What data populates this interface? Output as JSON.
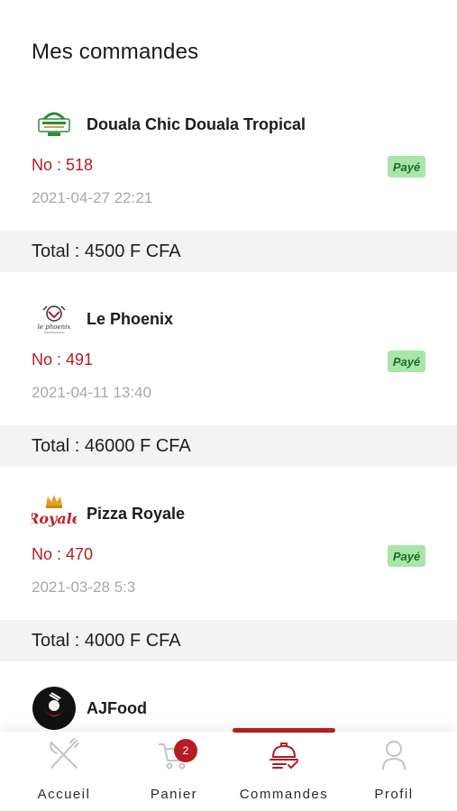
{
  "page": {
    "title": "Mes commandes"
  },
  "orders": [
    {
      "restaurant": "Douala Chic Douala Tropical",
      "number": "No : 518",
      "status": "Payé",
      "date": "2021-04-27 22:21",
      "total": "Total : 4500 F CFA",
      "logo": "douala-chic-logo"
    },
    {
      "restaurant": "Le Phoenix",
      "number": "No : 491",
      "status": "Payé",
      "date": "2021-04-11 13:40",
      "total": "Total : 46000 F CFA",
      "logo": "le-phoenix-logo"
    },
    {
      "restaurant": "Pizza Royale",
      "number": "No : 470",
      "status": "Payé",
      "date": "2021-03-28 5:3",
      "total": "Total : 4000 F CFA",
      "logo": "pizza-royale-logo"
    },
    {
      "restaurant": "AJFood",
      "logo": "ajfood-logo"
    }
  ],
  "nav": {
    "items": [
      {
        "label": "Accueil",
        "icon": "fork-knife-icon"
      },
      {
        "label": "Panier",
        "icon": "cart-icon",
        "badge": "2"
      },
      {
        "label": "Commandes",
        "icon": "cloche-icon",
        "active": true
      },
      {
        "label": "Profil",
        "icon": "user-icon"
      }
    ]
  },
  "colors": {
    "accent": "#b51d22",
    "status_bg": "#a8e6a8",
    "date": "#a8a8a8",
    "total_bg": "#f3f3f3"
  }
}
